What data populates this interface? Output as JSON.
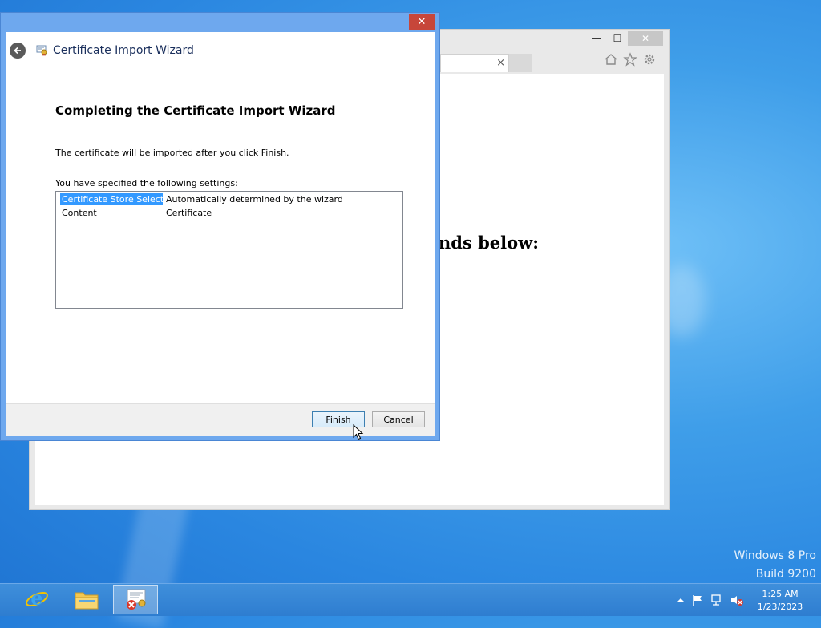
{
  "ie_window": {
    "heading_partial": "nds below:",
    "tab_close": "×",
    "caption": {
      "minimize": "—",
      "maximize": "☐",
      "close": "✕"
    }
  },
  "wizard": {
    "title": "Certificate Import Wizard",
    "close": "✕",
    "heading": "Completing the Certificate Import Wizard",
    "info_text": "The certificate will be imported after you click Finish.",
    "settings_label": "You have specified the following settings:",
    "settings": [
      {
        "key": "Certificate Store Selected",
        "value": "Automatically determined by the wizard"
      },
      {
        "key": "Content",
        "value": "Certificate"
      }
    ],
    "finish_label": "Finish",
    "cancel_label": "Cancel"
  },
  "watermark": {
    "line1": "Windows 8 Pro",
    "line2": "Build 9200"
  },
  "taskbar": {
    "items": [
      {
        "name": "Internet Explorer",
        "icon": "ie-icon"
      },
      {
        "name": "File Explorer",
        "icon": "folder-icon"
      },
      {
        "name": "Certificate Import Wizard",
        "icon": "certificate-icon",
        "active": true
      }
    ],
    "time": "1:25 AM",
    "date": "1/23/2023"
  },
  "colors": {
    "accent": "#3399ff",
    "desktop": "#2a86e0",
    "close_red": "#c7463a"
  }
}
